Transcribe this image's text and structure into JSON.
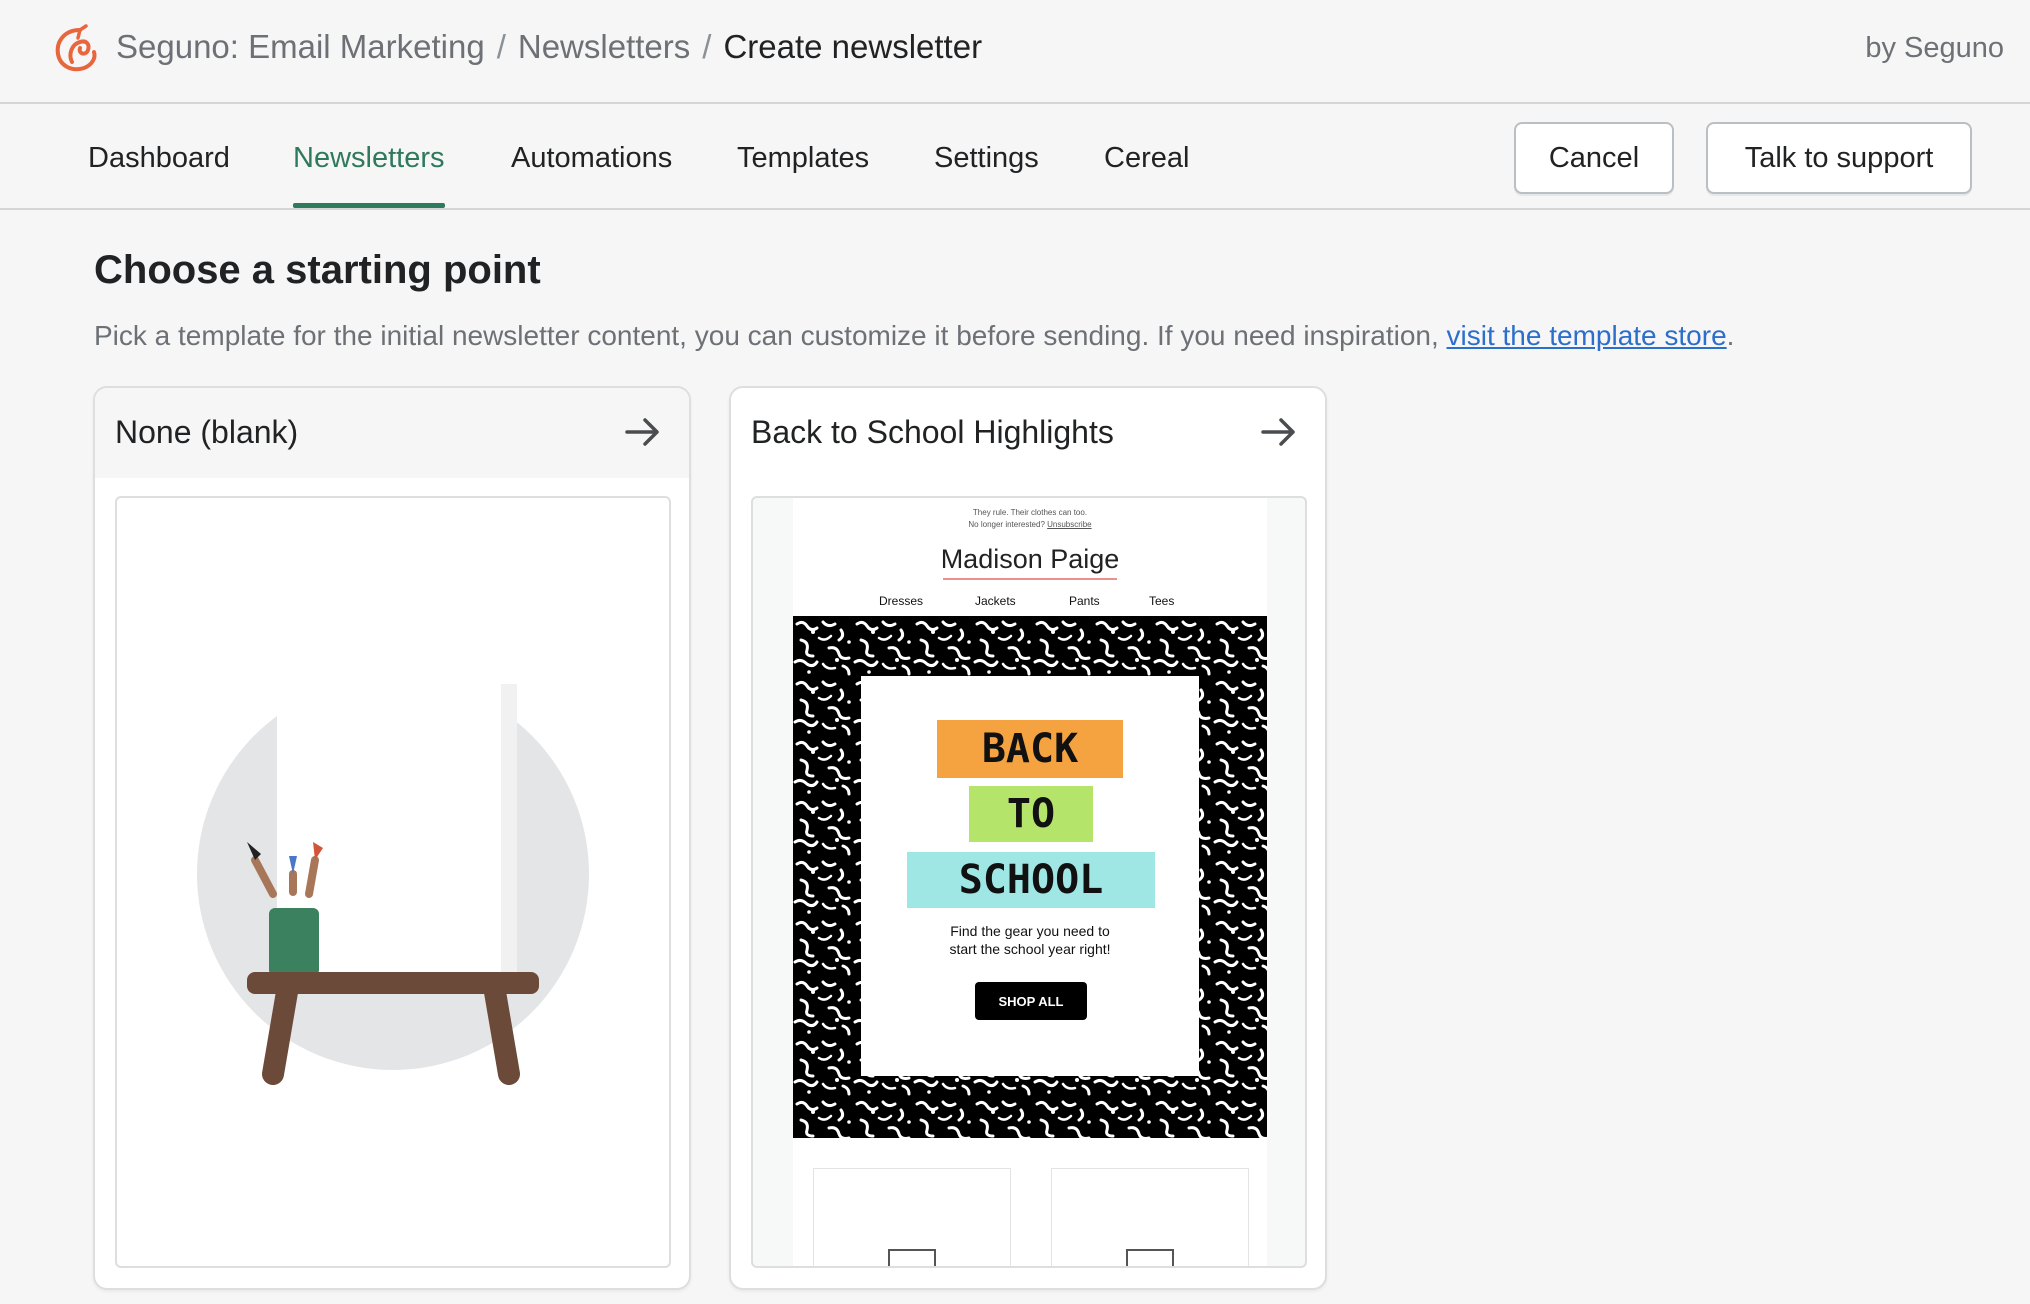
{
  "header": {
    "app_name": "Seguno: Email Marketing",
    "breadcrumb_parent": "Newsletters",
    "breadcrumb_current": "Create newsletter",
    "separator": "/",
    "by_label": "by Seguno",
    "logo_icon": "seguno-logo-icon",
    "logo_color": "#e8663d"
  },
  "nav": {
    "tabs": [
      {
        "label": "Dashboard",
        "active": false
      },
      {
        "label": "Newsletters",
        "active": true
      },
      {
        "label": "Automations",
        "active": false
      },
      {
        "label": "Templates",
        "active": false
      },
      {
        "label": "Settings",
        "active": false
      },
      {
        "label": "Cereal",
        "active": false
      }
    ],
    "cancel_label": "Cancel",
    "support_label": "Talk to support",
    "accent_color": "#2f7a5c"
  },
  "main": {
    "title": "Choose a starting point",
    "description": "Pick a template for the initial newsletter content, you can customize it before sending. If you need inspiration, ",
    "link_text": "visit the template store",
    "description_end": ".",
    "link_color": "#2c6ecb"
  },
  "cards": [
    {
      "title": "None (blank)",
      "arrow_icon": "arrow-right-icon"
    },
    {
      "title": "Back to School Highlights",
      "arrow_icon": "arrow-right-icon",
      "email": {
        "preheader_1": "They rule. Their clothes can too.",
        "preheader_2": "No longer interested? ",
        "unsubscribe": "Unsubscribe",
        "brand": "Madison Paige",
        "nav": [
          "Dresses",
          "Jackets",
          "Pants",
          "Tees"
        ],
        "hero_words": [
          {
            "text": "BACK",
            "color": "#f4a340"
          },
          {
            "text": "TO",
            "color": "#b5e46a"
          },
          {
            "text": "SCHOOL",
            "color": "#9ee7e5"
          }
        ],
        "subtext_1": "Find the gear you need to",
        "subtext_2": "start the school year right!",
        "cta": "SHOP ALL"
      }
    }
  ]
}
